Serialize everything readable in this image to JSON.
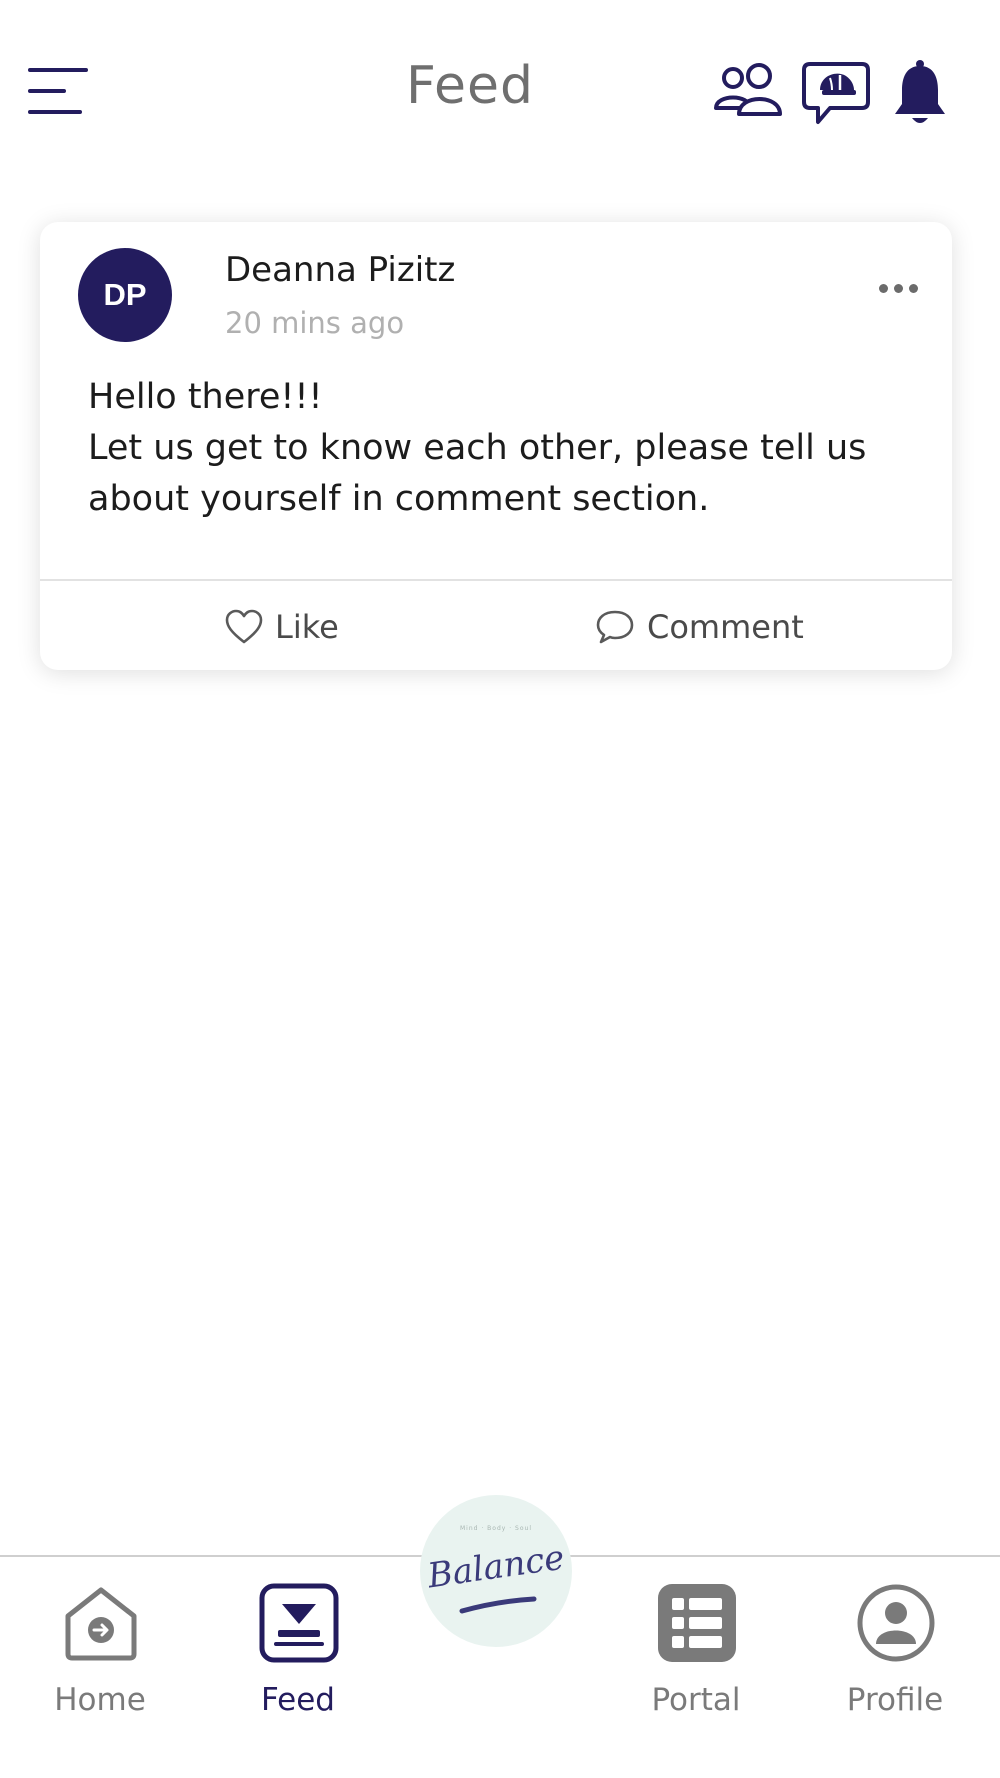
{
  "header": {
    "title": "Feed",
    "icons": {
      "menu": "hamburger-menu-icon",
      "community": "community-people-icon",
      "support": "support-chat-icon",
      "notifications": "bell-icon"
    }
  },
  "post": {
    "avatar_initials": "DP",
    "author": "Deanna Pizitz",
    "time": "20 mins ago",
    "body_lines": [
      "Hello there!!!",
      "Let us get to know each other, please tell us about yourself in comment section."
    ],
    "like_label": "Like",
    "comment_label": "Comment"
  },
  "nav": {
    "home": "Home",
    "feed": "Feed",
    "portal": "Portal",
    "profile": "Profile",
    "active": "feed"
  },
  "center_logo": {
    "word": "Balance",
    "tagline": "Mind · Body · Soul"
  },
  "colors": {
    "brand": "#231c5e",
    "icon_gray": "#7a7a7a",
    "muted_text": "#b0b0b0",
    "logo_bg": "#e9f3f0"
  }
}
